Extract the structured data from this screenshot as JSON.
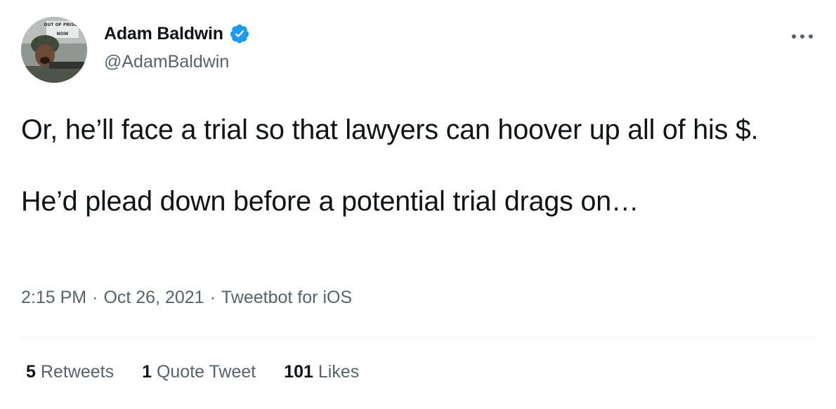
{
  "author": {
    "display_name": "Adam Baldwin",
    "handle": "@AdamBaldwin",
    "verified": true,
    "verified_color": "#1d9bf0",
    "avatar_caption": "OUT OF PRISON NOW"
  },
  "tweet": {
    "paragraphs": [
      "Or, he’ll face a trial so that lawyers can hoover up all of his $.",
      "He’d plead down before a potential trial drags on…"
    ]
  },
  "meta": {
    "time": "2:15 PM",
    "separator": "·",
    "date": "Oct 26, 2021",
    "source": "Tweetbot for iOS"
  },
  "stats": {
    "retweets": {
      "count": "5",
      "label": "Retweets"
    },
    "quote_tweets": {
      "count": "1",
      "label": "Quote Tweet"
    },
    "likes": {
      "count": "101",
      "label": "Likes"
    }
  },
  "icons": {
    "more": "more-options-icon",
    "verified": "verified-badge-icon"
  }
}
